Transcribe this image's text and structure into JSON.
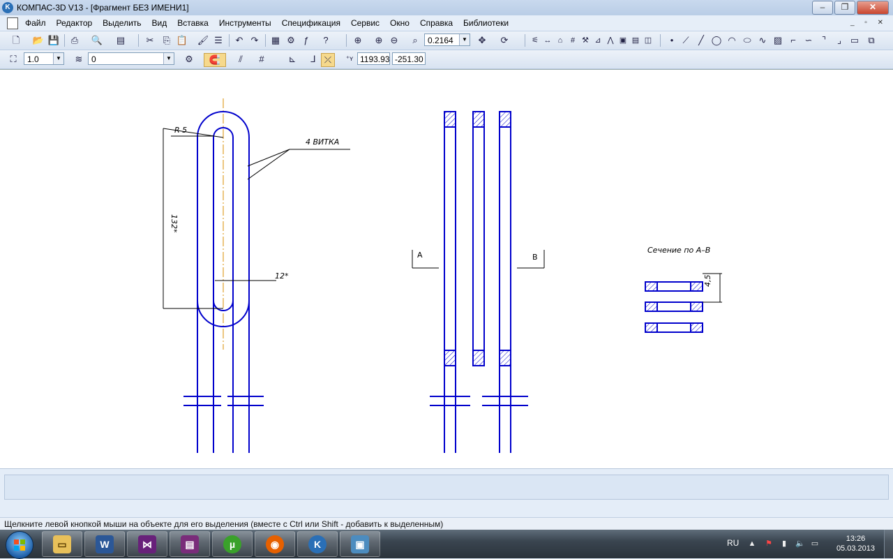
{
  "window": {
    "title": "КОМПАС-3D V13 - [Фрагмент БЕЗ ИМЕНИ1]",
    "app_icon_letter": "K"
  },
  "menu": [
    "Файл",
    "Редактор",
    "Выделить",
    "Вид",
    "Вставка",
    "Инструменты",
    "Спецификация",
    "Сервис",
    "Окно",
    "Справка",
    "Библиотеки"
  ],
  "toolbar": {
    "zoom_value": "0.2164",
    "step_value": "1.0",
    "layer_value": "0",
    "coord_x": "1193.93",
    "coord_y": "-251.30"
  },
  "drawing": {
    "label_radius": "R 5",
    "label_turns": "4 ВИТКА",
    "label_length": "132*",
    "label_width": "12*",
    "label_section_title": "Сечение по А–В",
    "label_thickness": "4,5",
    "label_a": "А",
    "label_b": "В",
    "line_color": "#0000cc",
    "axis_color": "#d98c00"
  },
  "status": {
    "hint": "Щелкните левой кнопкой мыши на объекте для его выделения (вместе с Ctrl или Shift - добавить к выделенным)"
  },
  "taskbar": {
    "apps": [
      "explorer-icon",
      "word-icon",
      "visual-studio-icon",
      "winrar-icon",
      "utorrent-icon",
      "firefox-icon",
      "kompas-icon",
      "image-viewer-icon"
    ],
    "language": "RU",
    "time": "13:26",
    "date": "05.03.2013"
  }
}
